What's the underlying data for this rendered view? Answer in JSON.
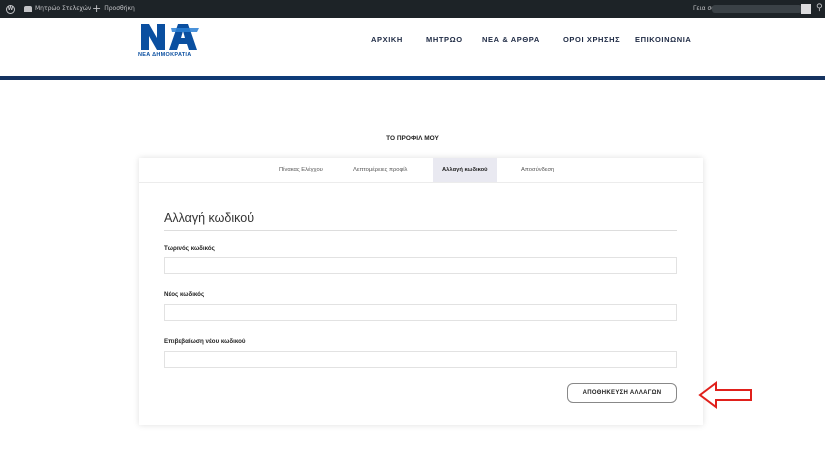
{
  "admin_bar": {
    "site_name": "Μητρώο Στελεχών",
    "new_label": "Προσθήκη",
    "greeting": "Γεια σου,"
  },
  "header": {
    "logo_text": "ΝΕΑ ΔΗΜΟΚΡΑΤΙΑ",
    "nav": [
      "ΑΡΧΙΚΗ",
      "ΜΗΤΡΩΟ",
      "ΝΕΑ & ΑΡΘΡΑ",
      "ΟΡΟΙ ΧΡΗΣΗΣ",
      "ΕΠΙΚΟΙΝΩΝΙΑ"
    ]
  },
  "page": {
    "title": "ΤΟ ΠΡΟΦΙΛ ΜΟΥ"
  },
  "tabs": [
    {
      "label": "Πίνακας Ελέγχου",
      "active": false
    },
    {
      "label": "Λεπτομέρειες προφίλ",
      "active": false
    },
    {
      "label": "Αλλαγή κωδικού",
      "active": true
    },
    {
      "label": "Αποσύνδεση",
      "active": false
    }
  ],
  "form": {
    "title": "Αλλαγή κωδικού",
    "fields": [
      {
        "label": "Τωρινός κωδικός",
        "value": ""
      },
      {
        "label": "Νέος κωδικός",
        "value": ""
      },
      {
        "label": "Επιβεβαίωση νέου κωδικού",
        "value": ""
      }
    ],
    "save_label": "ΑΠΟΘΗΚΕΥΣΗ ΑΛΛΑΓΩΝ"
  },
  "colors": {
    "admin_bar": "#1d2327",
    "brand_blue": "#0a4fa0",
    "annotation_red": "#e0201b"
  }
}
